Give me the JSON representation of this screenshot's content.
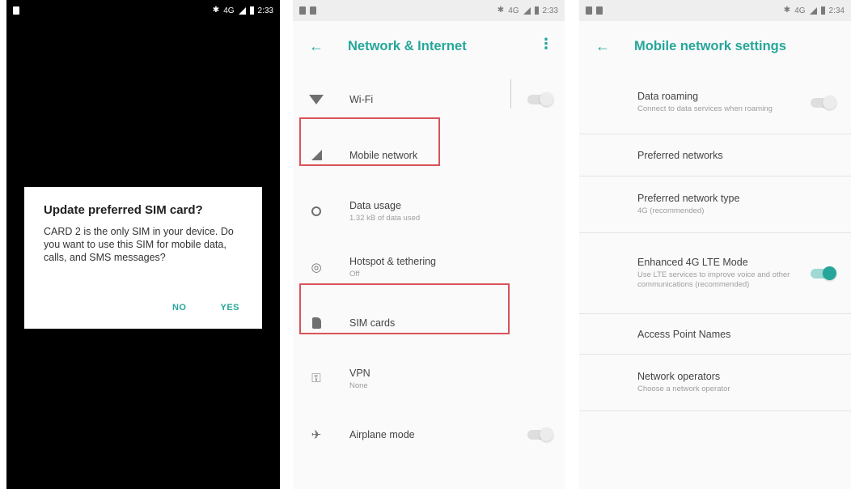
{
  "screen1": {
    "status_time": "2:33",
    "status_network": "4G",
    "dialog": {
      "title": "Update preferred SIM card?",
      "message": "CARD 2 is the only SIM in your device. Do you want to use this SIM for mobile data, calls, and SMS messages?",
      "no_label": "NO",
      "yes_label": "YES"
    }
  },
  "screen2": {
    "status_time": "2:33",
    "status_network": "4G",
    "title": "Network & Internet",
    "items": [
      {
        "label": "Wi-Fi",
        "sub": "",
        "icon": "wifi-icon",
        "toggle": false
      },
      {
        "label": "Mobile network",
        "sub": "",
        "icon": "signal-icon"
      },
      {
        "label": "Data usage",
        "sub": "1.32 kB of data used",
        "icon": "data-usage-icon"
      },
      {
        "label": "Hotspot & tethering",
        "sub": "Off",
        "icon": "hotspot-icon"
      },
      {
        "label": "SIM cards",
        "sub": "",
        "icon": "sim-card-icon"
      },
      {
        "label": "VPN",
        "sub": "None",
        "icon": "vpn-key-icon"
      },
      {
        "label": "Airplane mode",
        "sub": "",
        "icon": "airplane-icon",
        "toggle": false
      }
    ]
  },
  "screen3": {
    "status_time": "2:34",
    "status_network": "4G",
    "title": "Mobile network settings",
    "items": [
      {
        "label": "Data roaming",
        "sub": "Connect to data services when roaming",
        "toggle": false
      },
      {
        "label": "Preferred networks",
        "sub": ""
      },
      {
        "label": "Preferred network type",
        "sub": "4G (recommended)"
      },
      {
        "label": "Enhanced 4G LTE Mode",
        "sub": "Use LTE services to improve voice and other communications (recommended)",
        "toggle": true
      },
      {
        "label": "Access Point Names",
        "sub": ""
      },
      {
        "label": "Network operators",
        "sub": "Choose a network operator"
      }
    ]
  },
  "colors": {
    "accent": "#26a69a",
    "highlight": "#d9535a"
  }
}
